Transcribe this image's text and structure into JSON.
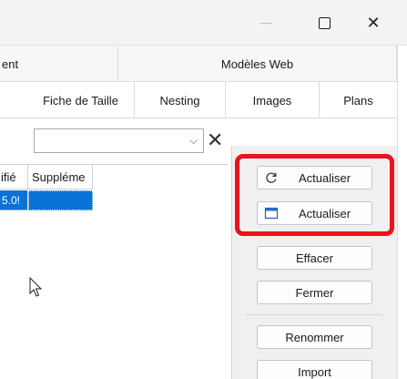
{
  "window": {
    "minimize_icon": "minimize-icon",
    "maximize_icon": "maximize-icon",
    "close_glyph": "✕"
  },
  "tabs_top": [
    {
      "label": "ent"
    },
    {
      "label": "Modèles Web"
    }
  ],
  "tabs_main": [
    {
      "label": "Fiche de Taille"
    },
    {
      "label": "Nesting"
    },
    {
      "label": "Images"
    },
    {
      "label": "Plans"
    }
  ],
  "filter": {
    "combo_value": "",
    "clear_glyph": "✕",
    "arrow_glyph": "⌵"
  },
  "grid": {
    "columns": [
      {
        "label": "ifié"
      },
      {
        "label": "Suppléme"
      }
    ],
    "rows": [
      {
        "cells": [
          "5.0!",
          ""
        ]
      }
    ]
  },
  "buttons": {
    "refresh_label": "Actualiser",
    "refresh2_label": "Actualiser",
    "clear_label": "Effacer",
    "close_label": "Fermer",
    "rename_label": "Renommer",
    "import_label": "Import"
  },
  "colors": {
    "selection": "#0a72d6",
    "highlight": "#e8141b"
  }
}
